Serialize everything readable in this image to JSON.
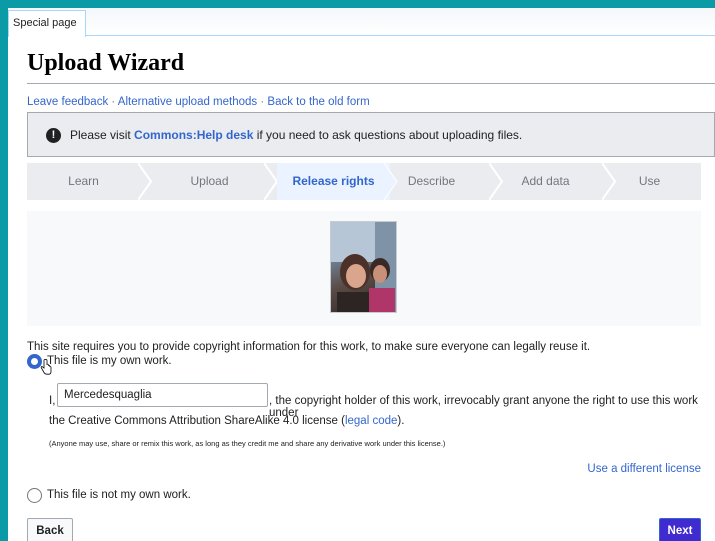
{
  "tab": {
    "label": "Special page"
  },
  "page": {
    "title": "Upload Wizard"
  },
  "links": {
    "feedback": "Leave feedback",
    "alternative": "Alternative upload methods",
    "old_form": "Back to the old form",
    "separator": " · "
  },
  "notice": {
    "icon": "!",
    "prefix": "Please visit ",
    "link": "Commons:Help desk",
    "suffix": " if you need to ask questions about uploading files."
  },
  "steps": [
    {
      "label": "Learn",
      "active": false
    },
    {
      "label": "Upload",
      "active": false
    },
    {
      "label": "Release rights",
      "active": true
    },
    {
      "label": "Describe",
      "active": false
    },
    {
      "label": "Add data",
      "active": false
    },
    {
      "label": "Use",
      "active": false
    }
  ],
  "copyright": {
    "intro": "This site requires you to provide copyright information for this work, to make sure everyone can legally reuse it.",
    "own_work_label": "This file is my own work.",
    "grant_prefix": "I,",
    "author_name": "Mercedesquaglia",
    "grant_suffix": ", the copyright holder of this work, irrevocably grant anyone the right to use this work under",
    "license_text": "the Creative Commons Attribution ShareAlike 4.0 license (",
    "legal_code_link": "legal code",
    "license_close": ").",
    "fine_print": "(Anyone may use, share or remix this work, as long as they credit me and share any derivative work under this license.)",
    "different_license": "Use a different license",
    "not_own_work_label": "This file is not my own work."
  },
  "buttons": {
    "back": "Back",
    "next": "Next"
  },
  "colors": {
    "accent": "#3366cc",
    "next_button": "#3f2bcf",
    "frame": "#0a9ba6"
  }
}
